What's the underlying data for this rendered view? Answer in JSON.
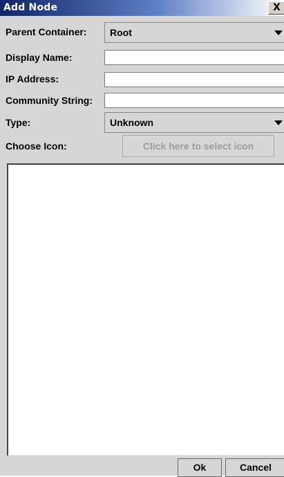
{
  "window": {
    "title": "Add Node",
    "close_glyph": "X"
  },
  "form": {
    "parent_container": {
      "label": "Parent Container:",
      "value": "Root"
    },
    "display_name": {
      "label": "Display Name:",
      "value": ""
    },
    "ip_address": {
      "label": "IP Address:",
      "value": ""
    },
    "community_string": {
      "label": "Community String:",
      "value": ""
    },
    "type": {
      "label": "Type:",
      "value": "Unknown"
    },
    "choose_icon": {
      "label": "Choose Icon:",
      "button_label": "Click here to select icon"
    }
  },
  "footer": {
    "ok_label": "Ok",
    "cancel_label": "Cancel"
  },
  "colors": {
    "title_gradient_start": "#10246a",
    "panel_bg": "#d6d6d6",
    "disabled_text": "#9c9c9c"
  },
  "icons": {
    "close": "close-icon",
    "dropdown": "chevron-down-icon"
  }
}
